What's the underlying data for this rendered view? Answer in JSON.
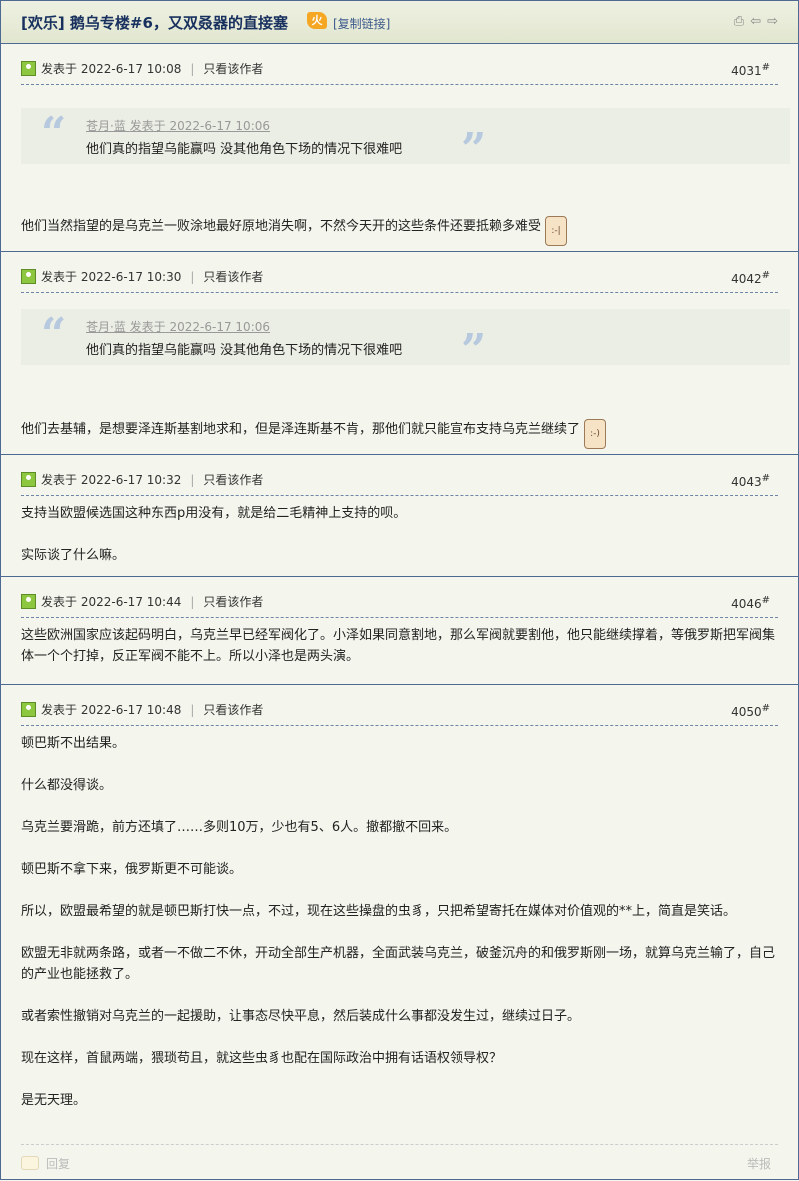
{
  "header": {
    "title": "[欢乐] 鹅乌专楼#6，又双叒器的直接塞",
    "fire_badge": "火",
    "copy_link": "[复制链接]",
    "icons": [
      "printer-icon",
      "prev-arrow-icon",
      "next-arrow-icon"
    ]
  },
  "labels": {
    "posted_at": "发表于",
    "only_author": "只看该作者",
    "quote_posted_at": "发表于",
    "floor_mark": "#"
  },
  "posts": [
    {
      "time": "2022-6-17 10:08",
      "floor": "4031",
      "quote": {
        "author": "苍月·蓝",
        "time": "2022-6-17 10:06",
        "text": "他们真的指望乌能赢吗 没其他角色下场的情况下很难吧"
      },
      "paragraphs": [
        "他们当然指望的是乌克兰一败涂地最好原地消失啊，不然今天开的这些条件还要抵赖多难受"
      ]
    },
    {
      "time": "2022-6-17 10:30",
      "floor": "4042",
      "quote": {
        "author": "苍月·蓝",
        "time": "2022-6-17 10:06",
        "text": "他们真的指望乌能赢吗 没其他角色下场的情况下很难吧"
      },
      "paragraphs": [
        "他们去基辅，是想要泽连斯基割地求和，但是泽连斯基不肯，那他们就只能宣布支持乌克兰继续了"
      ]
    },
    {
      "time": "2022-6-17 10:32",
      "floor": "4043",
      "paragraphs": [
        "支持当欧盟候选国这种东西p用没有，就是给二毛精神上支持的呗。",
        "实际谈了什么嘛。"
      ]
    },
    {
      "time": "2022-6-17 10:44",
      "floor": "4046",
      "paragraphs": [
        "这些欧洲国家应该起码明白，乌克兰早已经军阀化了。小泽如果同意割地，那么军阀就要割他，他只能继续撑着，等俄罗斯把军阀集体一个个打掉，反正军阀不能不上。所以小泽也是两头演。"
      ]
    },
    {
      "time": "2022-6-17 10:48",
      "floor": "4050",
      "paragraphs": [
        "顿巴斯不出结果。",
        "什么都没得谈。",
        "乌克兰要滑跪，前方还填了……多则10万，少也有5、6人。撤都撤不回来。",
        "顿巴斯不拿下来，俄罗斯更不可能谈。",
        "所以，欧盟最希望的就是顿巴斯打快一点，不过，现在这些操盘的虫豸，只把希望寄托在媒体对价值观的**上，简直是笑话。",
        "欧盟无非就两条路，或者一不做二不休，开动全部生产机器，全面武装乌克兰，破釜沉舟的和俄罗斯刚一场，就算乌克兰输了，自己的产业也能拯救了。",
        "或者索性撤销对乌克兰的一起援助，让事态尽快平息，然后装成什么事都没发生过，继续过日子。",
        "现在这样，首鼠两端，猥琐苟且，就这些虫豸也配在国际政治中拥有话语权领导权？",
        "是无天理。"
      ]
    }
  ],
  "footer": {
    "reply": "回复",
    "report": "举报"
  }
}
